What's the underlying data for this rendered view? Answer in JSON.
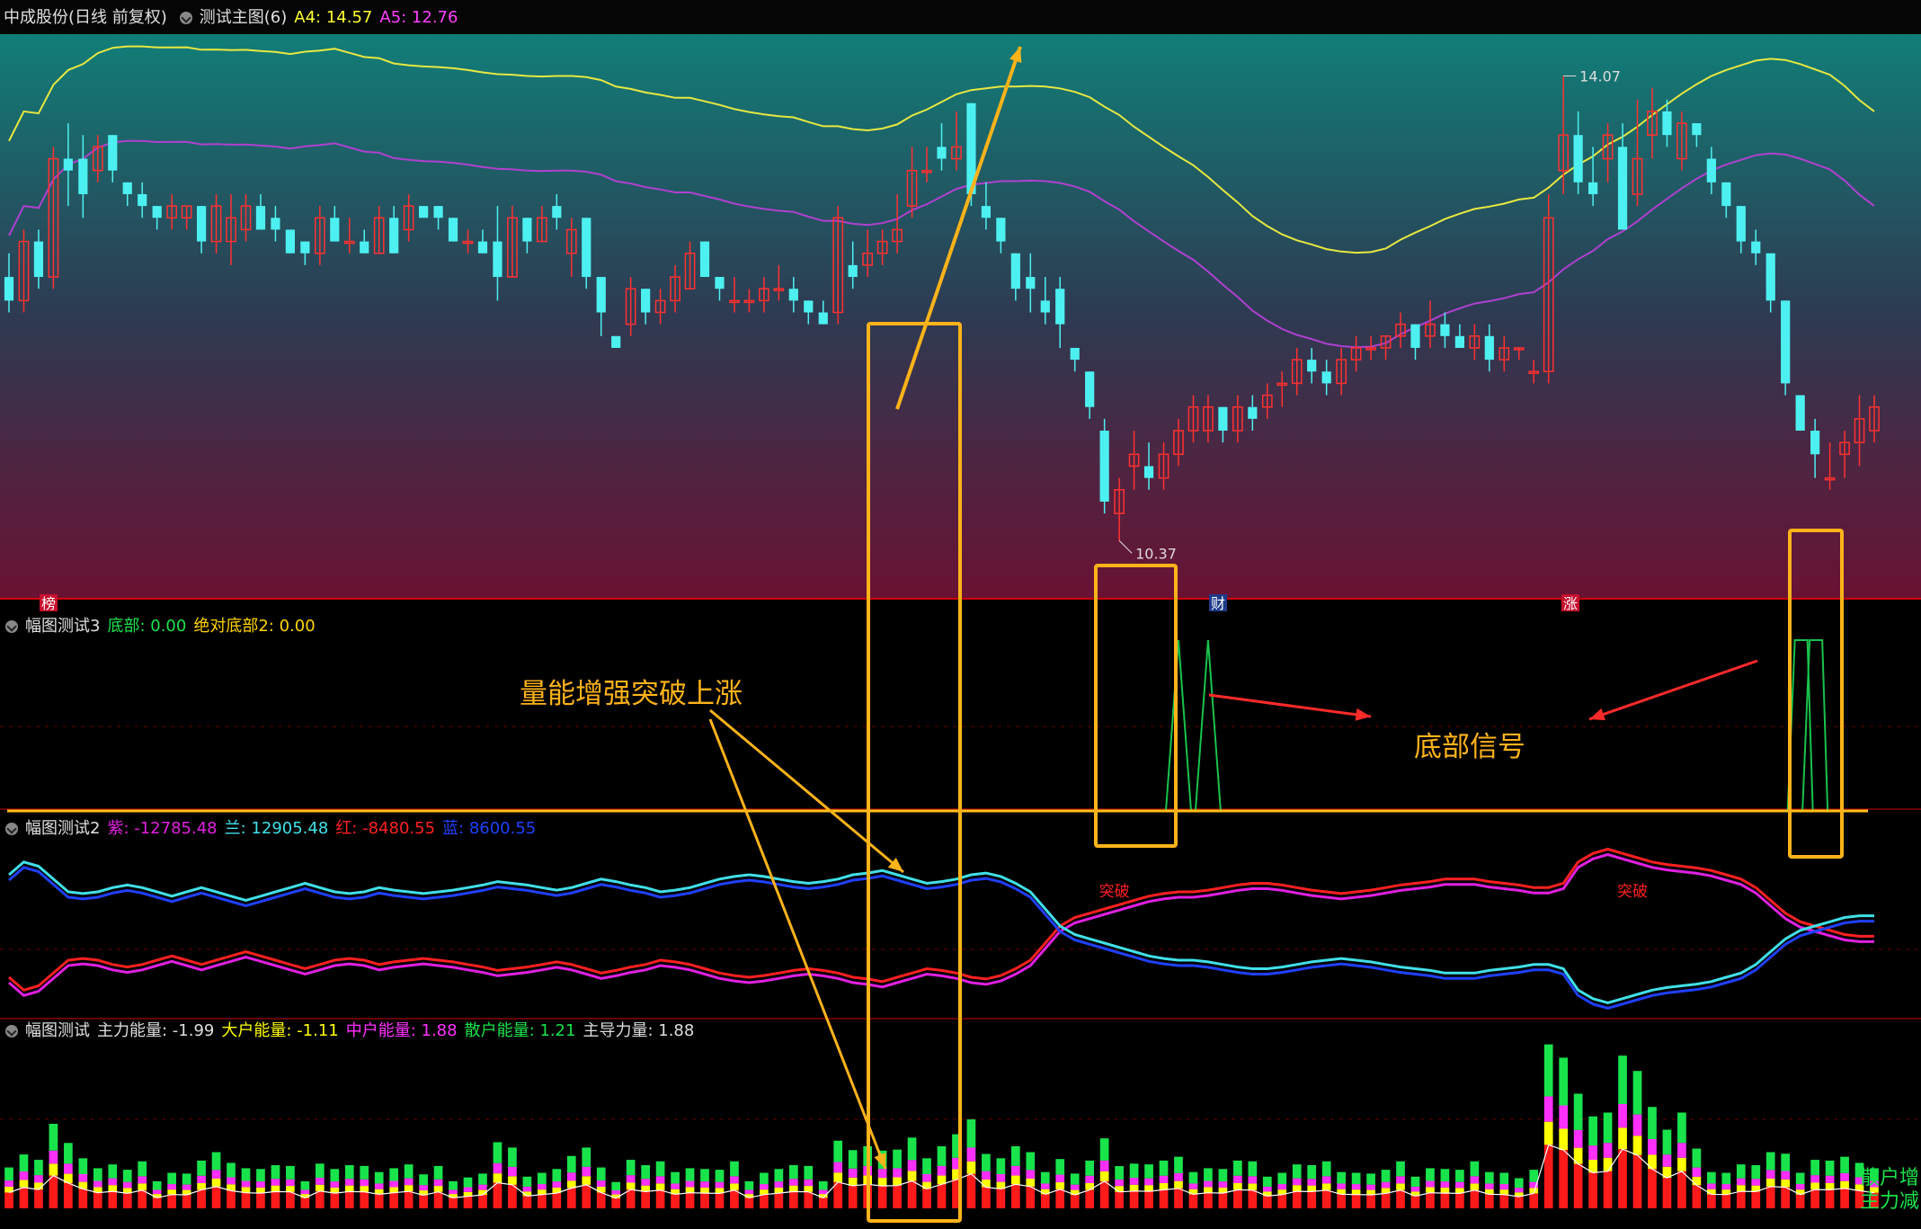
{
  "header": {
    "stock_name": "中成股份",
    "period": "(日线 前复权)",
    "indicator": "测试主图(6)",
    "a4_label": "A4: 14.57",
    "a5_label": "A5: 12.76"
  },
  "price_panel": {
    "high_label": "14.07",
    "low_label": "10.37",
    "tags": [
      "榜",
      "财",
      "涨"
    ]
  },
  "panel2": {
    "title": "幅图测试3",
    "items": [
      {
        "text": "底部: 0.00",
        "color": "#19e34b"
      },
      {
        "text": "绝对底部2: 0.00",
        "color": "#ffd400"
      }
    ]
  },
  "panel3": {
    "title": "幅图测试2",
    "items": [
      {
        "text": "紫: -12785.48",
        "color": "#e020e0"
      },
      {
        "text": "兰: 12905.48",
        "color": "#40e0e8"
      },
      {
        "text": "红: -8480.55",
        "color": "#ff2020"
      },
      {
        "text": "蓝: 8600.55",
        "color": "#2040ff"
      }
    ],
    "cross_label": "突破"
  },
  "panel4": {
    "title": "幅图测试",
    "items": [
      {
        "text": "主力能量: -1.99",
        "color": "#dddddd"
      },
      {
        "text": "大户能量: -1.11",
        "color": "#ffff00"
      },
      {
        "text": "中户能量: 1.88",
        "color": "#ff30ff"
      },
      {
        "text": "散户能量: 1.21",
        "color": "#19e34b"
      },
      {
        "text": "主导力量: 1.88",
        "color": "#dddddd"
      }
    ],
    "side_labels": [
      "散户增",
      "主力减"
    ]
  },
  "annotations": {
    "volume_break": "量能增强突破上涨",
    "bottom_signal": "底部信号"
  },
  "colors": {
    "up": "#ff3030",
    "down": "#4df0f0",
    "yellow_line": "#e8e840",
    "purple_line": "#b040d0",
    "box": "#ffb31a",
    "arrow_red": "#ff2a2a"
  },
  "chart_data": {
    "type": "candlestick",
    "ohlc": [
      [
        12.6,
        12.8,
        12.3,
        12.4
      ],
      [
        12.4,
        13.0,
        12.3,
        12.9
      ],
      [
        12.9,
        13.0,
        12.5,
        12.6
      ],
      [
        12.6,
        13.7,
        12.5,
        13.6
      ],
      [
        13.6,
        13.9,
        13.2,
        13.5
      ],
      [
        13.6,
        13.8,
        13.1,
        13.3
      ],
      [
        13.5,
        13.8,
        13.4,
        13.7
      ],
      [
        13.8,
        13.8,
        13.4,
        13.5
      ],
      [
        13.4,
        13.4,
        13.2,
        13.3
      ],
      [
        13.3,
        13.4,
        13.1,
        13.2
      ],
      [
        13.2,
        13.2,
        13.0,
        13.1
      ],
      [
        13.1,
        13.3,
        13.0,
        13.2
      ],
      [
        13.1,
        13.2,
        13.0,
        13.2
      ],
      [
        13.2,
        13.2,
        12.8,
        12.9
      ],
      [
        12.9,
        13.3,
        12.8,
        13.2
      ],
      [
        12.9,
        13.3,
        12.7,
        13.1
      ],
      [
        13.0,
        13.3,
        12.9,
        13.2
      ],
      [
        13.2,
        13.3,
        13.0,
        13.0
      ],
      [
        13.1,
        13.2,
        12.9,
        13.0
      ],
      [
        13.0,
        13.0,
        12.8,
        12.8
      ],
      [
        12.9,
        12.9,
        12.7,
        12.8
      ],
      [
        12.8,
        13.2,
        12.7,
        13.1
      ],
      [
        13.1,
        13.2,
        12.9,
        12.9
      ],
      [
        12.9,
        13.1,
        12.8,
        12.9
      ],
      [
        12.9,
        13.0,
        12.8,
        12.8
      ],
      [
        12.8,
        13.2,
        12.8,
        13.1
      ],
      [
        13.1,
        13.2,
        12.8,
        12.8
      ],
      [
        13.0,
        13.3,
        12.9,
        13.2
      ],
      [
        13.2,
        13.2,
        13.1,
        13.1
      ],
      [
        13.2,
        13.2,
        13.0,
        13.1
      ],
      [
        13.1,
        13.1,
        12.9,
        12.9
      ],
      [
        12.9,
        13.0,
        12.8,
        12.9
      ],
      [
        12.9,
        13.0,
        12.8,
        12.8
      ],
      [
        12.9,
        13.2,
        12.4,
        12.6
      ],
      [
        12.6,
        13.2,
        12.6,
        13.1
      ],
      [
        13.1,
        13.1,
        12.8,
        12.9
      ],
      [
        12.9,
        13.2,
        12.9,
        13.1
      ],
      [
        13.2,
        13.3,
        13.0,
        13.1
      ],
      [
        12.8,
        13.1,
        12.6,
        13.0
      ],
      [
        13.1,
        13.1,
        12.5,
        12.6
      ],
      [
        12.6,
        12.6,
        12.1,
        12.3
      ],
      [
        12.1,
        12.1,
        12.0,
        12.0
      ],
      [
        12.2,
        12.6,
        12.1,
        12.5
      ],
      [
        12.5,
        12.5,
        12.2,
        12.3
      ],
      [
        12.3,
        12.5,
        12.2,
        12.4
      ],
      [
        12.4,
        12.7,
        12.3,
        12.6
      ],
      [
        12.5,
        12.9,
        12.5,
        12.8
      ],
      [
        12.9,
        12.9,
        12.6,
        12.6
      ],
      [
        12.6,
        12.6,
        12.4,
        12.5
      ],
      [
        12.4,
        12.6,
        12.3,
        12.4
      ],
      [
        12.4,
        12.5,
        12.3,
        12.4
      ],
      [
        12.4,
        12.6,
        12.3,
        12.5
      ],
      [
        12.5,
        12.7,
        12.4,
        12.5
      ],
      [
        12.5,
        12.6,
        12.3,
        12.4
      ],
      [
        12.4,
        12.4,
        12.2,
        12.3
      ],
      [
        12.3,
        12.4,
        12.2,
        12.2
      ],
      [
        12.3,
        13.2,
        12.2,
        13.1
      ],
      [
        12.7,
        12.9,
        12.5,
        12.6
      ],
      [
        12.7,
        13.0,
        12.6,
        12.8
      ],
      [
        12.8,
        13.0,
        12.7,
        12.9
      ],
      [
        12.9,
        13.3,
        12.8,
        13.0
      ],
      [
        13.2,
        13.7,
        13.1,
        13.5
      ],
      [
        13.5,
        13.7,
        13.4,
        13.5
      ],
      [
        13.7,
        13.9,
        13.5,
        13.6
      ],
      [
        13.6,
        14.0,
        13.5,
        13.7
      ],
      [
        14.07,
        14.07,
        13.2,
        13.3
      ],
      [
        13.2,
        13.4,
        13.0,
        13.1
      ],
      [
        13.1,
        13.1,
        12.8,
        12.9
      ],
      [
        12.8,
        12.8,
        12.4,
        12.5
      ],
      [
        12.6,
        12.8,
        12.3,
        12.5
      ],
      [
        12.4,
        12.6,
        12.2,
        12.3
      ],
      [
        12.5,
        12.6,
        12.0,
        12.2
      ],
      [
        12.0,
        12.0,
        11.8,
        11.9
      ],
      [
        11.8,
        11.8,
        11.4,
        11.5
      ],
      [
        11.3,
        11.4,
        10.6,
        10.7
      ],
      [
        10.6,
        10.9,
        10.37,
        10.8
      ],
      [
        11.0,
        11.3,
        10.8,
        11.1
      ],
      [
        11.0,
        11.2,
        10.8,
        10.9
      ],
      [
        10.9,
        11.2,
        10.8,
        11.1
      ],
      [
        11.1,
        11.4,
        11.0,
        11.3
      ],
      [
        11.3,
        11.6,
        11.2,
        11.5
      ],
      [
        11.3,
        11.6,
        11.2,
        11.5
      ],
      [
        11.5,
        11.5,
        11.2,
        11.3
      ],
      [
        11.3,
        11.6,
        11.2,
        11.5
      ],
      [
        11.5,
        11.6,
        11.3,
        11.4
      ],
      [
        11.5,
        11.7,
        11.4,
        11.6
      ],
      [
        11.7,
        11.8,
        11.5,
        11.7
      ],
      [
        11.7,
        12.0,
        11.6,
        11.9
      ],
      [
        11.9,
        12.0,
        11.7,
        11.8
      ],
      [
        11.8,
        11.9,
        11.6,
        11.7
      ],
      [
        11.7,
        12.0,
        11.6,
        11.9
      ],
      [
        11.9,
        12.1,
        11.8,
        12.0
      ],
      [
        12.0,
        12.1,
        11.9,
        12.0
      ],
      [
        12.0,
        12.1,
        11.9,
        12.1
      ],
      [
        12.1,
        12.3,
        12.0,
        12.2
      ],
      [
        12.2,
        12.2,
        11.9,
        12.0
      ],
      [
        12.1,
        12.4,
        12.0,
        12.2
      ],
      [
        12.2,
        12.3,
        12.0,
        12.1
      ],
      [
        12.1,
        12.2,
        12.0,
        12.0
      ],
      [
        12.0,
        12.2,
        11.9,
        12.1
      ],
      [
        12.1,
        12.2,
        11.8,
        11.9
      ],
      [
        11.9,
        12.1,
        11.8,
        12.0
      ],
      [
        12.0,
        12.0,
        11.9,
        12.0
      ],
      [
        11.8,
        11.9,
        11.7,
        11.8
      ],
      [
        11.8,
        13.3,
        11.7,
        13.1
      ],
      [
        13.5,
        14.3,
        13.3,
        13.8
      ],
      [
        13.8,
        14.0,
        13.3,
        13.4
      ],
      [
        13.4,
        13.7,
        13.2,
        13.3
      ],
      [
        13.6,
        13.9,
        13.4,
        13.8
      ],
      [
        13.7,
        13.9,
        13.0,
        13.0
      ],
      [
        13.3,
        14.1,
        13.2,
        13.6
      ],
      [
        13.8,
        14.2,
        13.6,
        14.0
      ],
      [
        14.0,
        14.1,
        13.7,
        13.8
      ],
      [
        13.6,
        14.0,
        13.5,
        13.9
      ],
      [
        13.9,
        13.9,
        13.7,
        13.8
      ],
      [
        13.6,
        13.7,
        13.3,
        13.4
      ],
      [
        13.4,
        13.4,
        13.1,
        13.2
      ],
      [
        13.2,
        13.2,
        12.8,
        12.9
      ],
      [
        12.9,
        13.0,
        12.7,
        12.8
      ],
      [
        12.8,
        12.8,
        12.3,
        12.4
      ],
      [
        12.4,
        12.4,
        11.6,
        11.7
      ],
      [
        11.6,
        11.6,
        11.3,
        11.3
      ],
      [
        11.3,
        11.4,
        10.9,
        11.1
      ],
      [
        10.9,
        11.2,
        10.8,
        10.9
      ],
      [
        11.1,
        11.3,
        10.9,
        11.2
      ],
      [
        11.2,
        11.6,
        11.0,
        11.4
      ],
      [
        11.3,
        11.6,
        11.2,
        11.5
      ]
    ],
    "bottom_signal_peaks": [
      [
        79,
        1
      ],
      [
        81,
        1
      ],
      [
        121,
        1
      ],
      [
        122,
        1
      ]
    ],
    "series": [
      {
        "name": "紫",
        "values": [
          -60,
          -75,
          -70,
          -55,
          -40,
          -38,
          -40,
          -45,
          -48,
          -45,
          -40,
          -35,
          -40,
          -45,
          -40,
          -35,
          -30,
          -35,
          -40,
          -45,
          -50,
          -45,
          -40,
          -38,
          -40,
          -45,
          -42,
          -40,
          -38,
          -40,
          -42,
          -45,
          -48,
          -52,
          -50,
          -48,
          -45,
          -42,
          -45,
          -50,
          -55,
          -52,
          -48,
          -45,
          -40,
          -42,
          -45,
          -50,
          -55,
          -58,
          -60,
          -58,
          -55,
          -52,
          -50,
          -52,
          -55,
          -60,
          -62,
          -65,
          -60,
          -55,
          -50,
          -52,
          -55,
          -60,
          -62,
          -58,
          -50,
          -40,
          -20,
          0,
          10,
          15,
          20,
          25,
          30,
          35,
          38,
          40,
          40,
          42,
          45,
          48,
          50,
          50,
          48,
          45,
          42,
          40,
          38,
          40,
          42,
          45,
          48,
          50,
          52,
          55,
          55,
          55,
          52,
          50,
          48,
          45,
          45,
          50,
          75,
          85,
          90,
          85,
          80,
          75,
          72,
          70,
          68,
          65,
          60,
          55,
          45,
          30,
          15,
          5,
          0,
          -5,
          -10,
          -12,
          -12
        ]
      },
      {
        "name": "兰",
        "values": [
          60,
          75,
          70,
          55,
          40,
          38,
          40,
          45,
          48,
          45,
          40,
          35,
          40,
          45,
          40,
          35,
          30,
          35,
          40,
          45,
          50,
          45,
          40,
          38,
          40,
          45,
          42,
          40,
          38,
          40,
          42,
          45,
          48,
          52,
          50,
          48,
          45,
          42,
          45,
          50,
          55,
          52,
          48,
          45,
          40,
          42,
          45,
          50,
          55,
          58,
          60,
          58,
          55,
          52,
          50,
          52,
          55,
          60,
          62,
          65,
          60,
          55,
          50,
          52,
          55,
          60,
          62,
          58,
          50,
          40,
          20,
          0,
          -10,
          -15,
          -20,
          -25,
          -30,
          -35,
          -38,
          -40,
          -40,
          -42,
          -45,
          -48,
          -50,
          -50,
          -48,
          -45,
          -42,
          -40,
          -38,
          -40,
          -42,
          -45,
          -48,
          -50,
          -52,
          -55,
          -55,
          -55,
          -52,
          -50,
          -48,
          -45,
          -45,
          -50,
          -75,
          -85,
          -90,
          -85,
          -80,
          -75,
          -72,
          -70,
          -68,
          -65,
          -60,
          -55,
          -45,
          -30,
          -15,
          -5,
          0,
          5,
          10,
          12,
          12
        ]
      }
    ],
    "ylim_price": [
      10.0,
      14.6
    ]
  }
}
